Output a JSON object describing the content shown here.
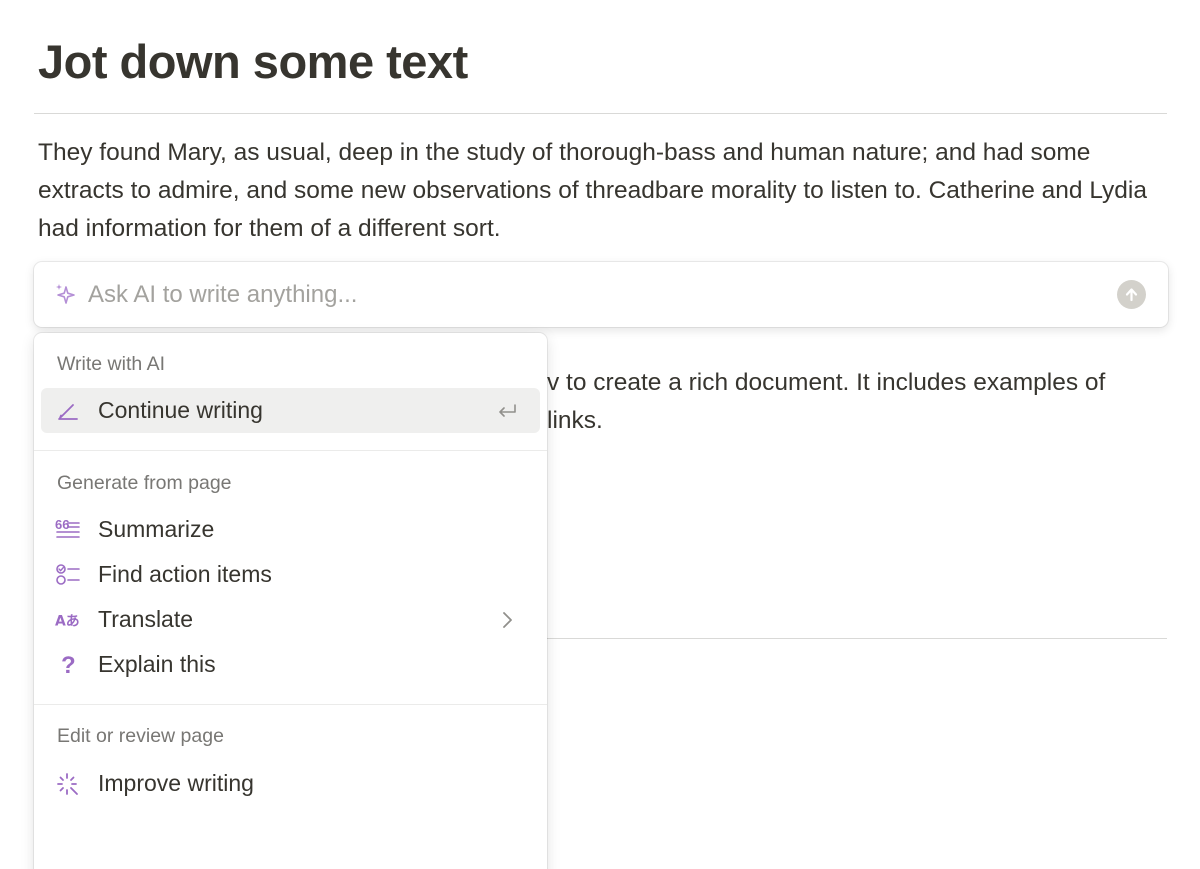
{
  "page": {
    "title": "Jot down some text",
    "paragraph": "They found Mary, as usual, deep in the study of thorough-bass and human nature; and had some extracts to admire, and some new observations of threadbare morality to listen to. Catherine and Lydia had information for them of a different sort.",
    "obscured_line_1": "v to create a rich document. It includes examples of",
    "obscured_line_2": " links."
  },
  "ai_bar": {
    "placeholder": "Ask AI to write anything...",
    "value": "",
    "sparkle_icon": "sparkle-icon",
    "send_icon": "arrow-up-icon"
  },
  "menu": {
    "sections": [
      {
        "label": "Write with AI",
        "items": [
          {
            "label": "Continue writing",
            "icon": "pencil-icon",
            "trail": "enter-key-icon",
            "active": true
          }
        ]
      },
      {
        "label": "Generate from page",
        "items": [
          {
            "label": "Summarize",
            "icon": "quote-lines-icon"
          },
          {
            "label": "Find action items",
            "icon": "checklist-icon"
          },
          {
            "label": "Translate",
            "icon": "translate-icon",
            "trail": "chevron-right-icon"
          },
          {
            "label": "Explain this",
            "icon": "question-icon"
          }
        ]
      },
      {
        "label": "Edit or review page",
        "items": [
          {
            "label": "Improve writing",
            "icon": "magic-burst-icon"
          }
        ]
      }
    ]
  },
  "colors": {
    "accent": "#9b6bc4",
    "text": "#37352f",
    "muted": "#787774",
    "active_bg": "#efefee"
  }
}
